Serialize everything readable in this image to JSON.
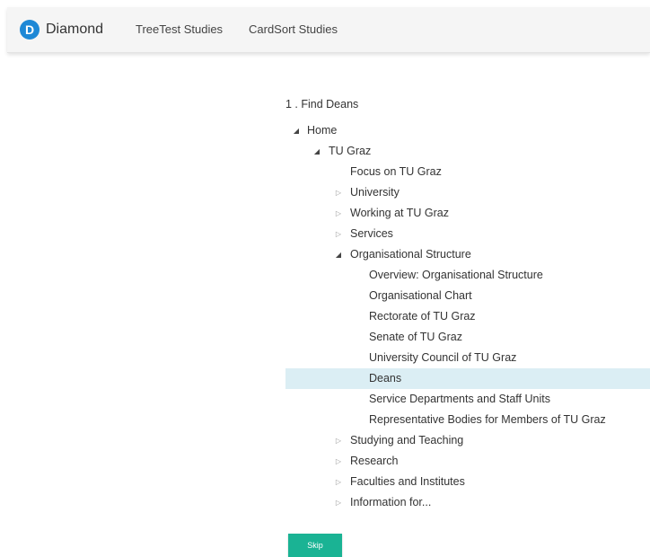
{
  "navbar": {
    "logo_letter": "D",
    "brand": "Diamond",
    "links": [
      "TreeTest Studies",
      "CardSort Studies"
    ]
  },
  "task": {
    "question": "1 . Find Deans"
  },
  "tree": [
    {
      "label": "Home",
      "depth": 0,
      "state": "expanded"
    },
    {
      "label": "TU Graz",
      "depth": 1,
      "state": "expanded"
    },
    {
      "label": "Focus on TU Graz",
      "depth": 2,
      "state": "leaf"
    },
    {
      "label": "University",
      "depth": 2,
      "state": "collapsed"
    },
    {
      "label": "Working at TU Graz",
      "depth": 2,
      "state": "collapsed"
    },
    {
      "label": "Services",
      "depth": 2,
      "state": "collapsed"
    },
    {
      "label": "Organisational Structure",
      "depth": 2,
      "state": "expanded"
    },
    {
      "label": "Overview: Organisational Structure",
      "depth": 3,
      "state": "leaf"
    },
    {
      "label": "Organisational Chart",
      "depth": 3,
      "state": "leaf"
    },
    {
      "label": "Rectorate of TU Graz",
      "depth": 3,
      "state": "leaf"
    },
    {
      "label": "Senate of TU Graz",
      "depth": 3,
      "state": "leaf"
    },
    {
      "label": "University Council of TU Graz",
      "depth": 3,
      "state": "leaf"
    },
    {
      "label": "Deans",
      "depth": 3,
      "state": "leaf",
      "selected": true
    },
    {
      "label": "Service Departments and Staff Units",
      "depth": 3,
      "state": "leaf"
    },
    {
      "label": "Representative Bodies for Members of TU Graz",
      "depth": 3,
      "state": "leaf"
    },
    {
      "label": "Studying and Teaching",
      "depth": 2,
      "state": "collapsed"
    },
    {
      "label": "Research",
      "depth": 2,
      "state": "collapsed"
    },
    {
      "label": "Faculties and Institutes",
      "depth": 2,
      "state": "collapsed"
    },
    {
      "label": "Information for...",
      "depth": 2,
      "state": "collapsed"
    }
  ],
  "actions": {
    "skip_label": "Skip"
  },
  "colors": {
    "brand_blue": "#1e88d6",
    "skip_button": "#1ab394",
    "selected_row": "#dbeef4"
  }
}
